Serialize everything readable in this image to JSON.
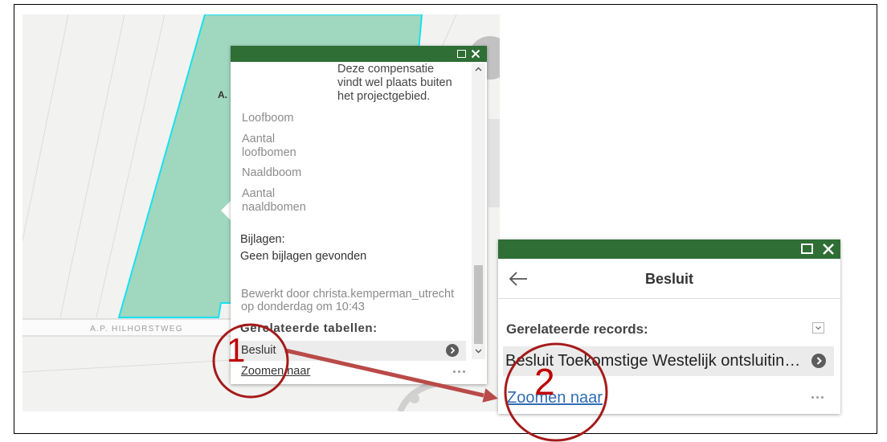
{
  "map": {
    "parcel_label": "A.",
    "road_label": "A.P. HILHORSTWEG",
    "parcel_fill": "#a0d7bf",
    "parcel_outline": "#19e0f0"
  },
  "popup_feature": {
    "header_icons": [
      "maximize-icon",
      "close-icon"
    ],
    "description_lines": [
      "Deze compensatie",
      "vindt wel plaats buiten",
      "het projectgebied."
    ],
    "fields": {
      "loofboom": "Loofboom",
      "aantal_loofbomen": "Aantal loofbomen",
      "naaldboom": "Naaldboom",
      "aantal_naaldbomen": "Aantal naaldbomen"
    },
    "attachments": {
      "label": "Bijlagen:",
      "value": "Geen bijlagen gevonden"
    },
    "edit_info": [
      "Bewerkt door christa.kemperman_utrecht",
      "op donderdag om 10:43"
    ],
    "related_tables": {
      "label": "Gerelateerde tabellen:",
      "items": [
        {
          "label": "Besluit",
          "icon": "chevron-right-icon"
        }
      ]
    },
    "zoom_link": "Zoomen naar",
    "more_icon": "more-options-icon",
    "scrollbar_icons": [
      "chevron-up-icon",
      "chevron-down-icon"
    ]
  },
  "popup_related": {
    "header_icons": [
      "maximize-icon",
      "close-icon"
    ],
    "back_icon": "arrow-left-icon",
    "title": "Besluit",
    "section_label": "Gerelateerde records:",
    "dropdown_icon": "caret-down-icon",
    "records": [
      {
        "label": "Besluit Toekomstige Westelijk ontsluitin…",
        "icon": "chevron-right-icon"
      }
    ],
    "zoom_link": "Zoomen naar",
    "more_icon": "more-options-icon"
  },
  "annotations": [
    {
      "label": "1"
    },
    {
      "label": "2"
    }
  ],
  "colors": {
    "header_green": "#2f6e34",
    "link_blue": "#2f6db5",
    "annotation_red": "#a51b1b",
    "arrow_red": "#b94a48"
  }
}
